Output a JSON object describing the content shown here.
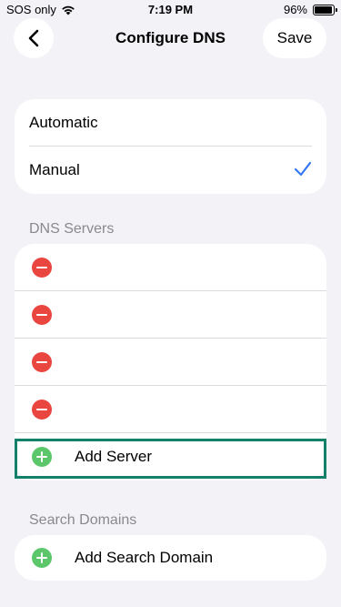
{
  "status_bar": {
    "carrier": "SOS only",
    "time": "7:19 PM",
    "battery_percent": "96%"
  },
  "nav": {
    "title": "Configure DNS",
    "save_label": "Save",
    "back_icon": "chevron-left-icon"
  },
  "mode": {
    "options": [
      {
        "label": "Automatic",
        "selected": false
      },
      {
        "label": "Manual",
        "selected": true
      }
    ]
  },
  "dns_servers": {
    "header": "DNS Servers",
    "servers": [
      "",
      "",
      "",
      ""
    ],
    "add_label": "Add Server"
  },
  "search_domains": {
    "header": "Search Domains",
    "add_label": "Add Search Domain"
  },
  "colors": {
    "accent": "#3478f6",
    "delete": "#e8463f",
    "add": "#5cc66b",
    "highlight": "#13806a"
  }
}
